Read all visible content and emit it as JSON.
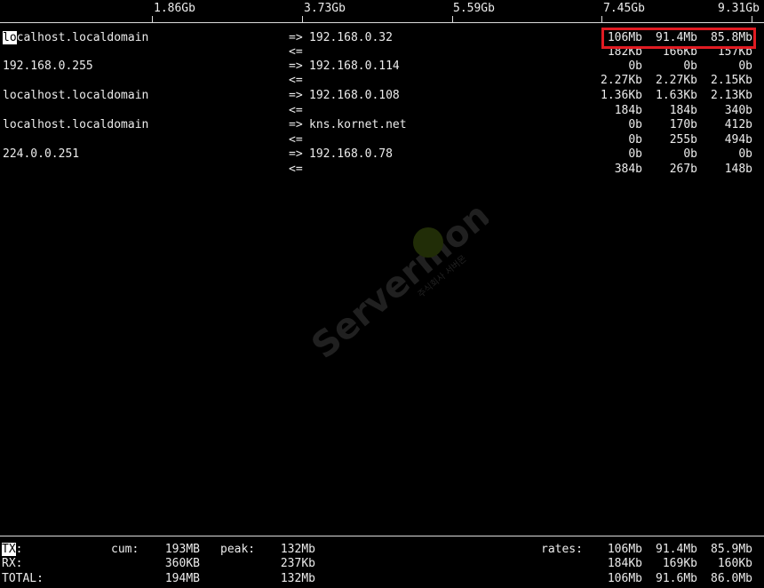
{
  "scale": {
    "ticks": [
      "1.86Gb",
      "3.73Gb",
      "5.59Gb",
      "7.45Gb",
      "9.31Gb"
    ]
  },
  "flows": [
    {
      "src_cursor": "lo",
      "src_rest": "calhost.localdomain",
      "dst": "192.168.0.32",
      "out_rates": [
        "106Mb",
        "91.4Mb",
        "85.8Mb"
      ],
      "in_rates": [
        "182Kb",
        "166Kb",
        "157Kb"
      ]
    },
    {
      "src": "192.168.0.255",
      "dst": "192.168.0.114",
      "out_rates": [
        "0b",
        "0b",
        "0b"
      ],
      "in_rates": [
        "2.27Kb",
        "2.27Kb",
        "2.15Kb"
      ]
    },
    {
      "src": "localhost.localdomain",
      "dst": "192.168.0.108",
      "out_rates": [
        "1.36Kb",
        "1.63Kb",
        "2.13Kb"
      ],
      "in_rates": [
        "184b",
        "184b",
        "340b"
      ]
    },
    {
      "src": "localhost.localdomain",
      "dst": "kns.kornet.net",
      "out_rates": [
        "0b",
        "170b",
        "412b"
      ],
      "in_rates": [
        "0b",
        "255b",
        "494b"
      ]
    },
    {
      "src": "224.0.0.251",
      "dst": "192.168.0.78",
      "out_rates": [
        "0b",
        "0b",
        "0b"
      ],
      "in_rates": [
        "384b",
        "267b",
        "148b"
      ]
    }
  ],
  "arrows": {
    "out": "=>",
    "in": "<="
  },
  "totals": {
    "tx": {
      "label": "TX",
      "colon": ":",
      "cum": "193MB",
      "peak": "132Mb",
      "rates": [
        "106Mb",
        "91.4Mb",
        "85.9Mb"
      ]
    },
    "rx": {
      "label": "RX:",
      "cum": "360KB",
      "peak": "237Kb",
      "rates": [
        "184Kb",
        "169Kb",
        "160Kb"
      ]
    },
    "total": {
      "label": "TOTAL:",
      "cum": "194MB",
      "peak": "132Mb",
      "rates": [
        "106Mb",
        "91.6Mb",
        "86.0Mb"
      ]
    },
    "cum_label": "cum:",
    "peak_label": "peak:",
    "rates_label": "rates:"
  },
  "watermark": {
    "brand": "Servermon",
    "korean": "주식회사 서버몬",
    "icon": "leaf-logo-icon",
    "color": "#7a7a7a",
    "accent": "#8fc31f"
  },
  "highlight_color": "#e11b22"
}
